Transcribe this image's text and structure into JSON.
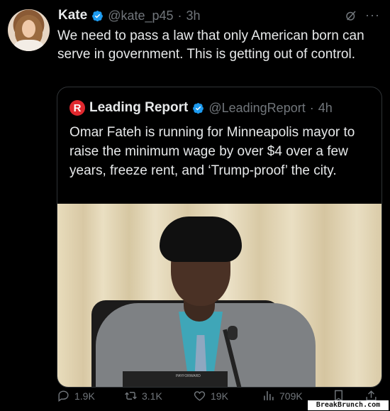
{
  "tweet": {
    "author_name": "Kate",
    "handle": "@kate_p45",
    "separator": "·",
    "time": "3h",
    "text": "We need to pass a law that only American born can serve in government. This is getting out of control."
  },
  "quote": {
    "logo_letter": "R",
    "author_name": "Leading Report",
    "handle": "@LeadingReport",
    "separator": "·",
    "time": "4h",
    "text": "Omar Fateh is running for Minneapolis mayor to raise the minimum wage by over $4 over a few years, freeze rent, and ‘Trump-proof’ the city.",
    "media_caption": "PAYFORWARD"
  },
  "actions": {
    "replies": "1.9K",
    "reposts": "3.1K",
    "likes": "19K",
    "views": "709K"
  },
  "watermark": "BreakBrunch.com",
  "colors": {
    "background": "#000000",
    "text": "#e7e9ea",
    "muted": "#71767b",
    "verified": "#1d9bf0",
    "leading_report_logo": "#e0282e"
  },
  "icons": {
    "verified": "verified-badge-icon",
    "grok": "grok-icon",
    "more": "more-dots-icon",
    "reply": "reply-icon",
    "repost": "repost-icon",
    "like": "heart-icon",
    "views": "views-chart-icon",
    "bookmark": "bookmark-icon",
    "share": "share-icon"
  }
}
